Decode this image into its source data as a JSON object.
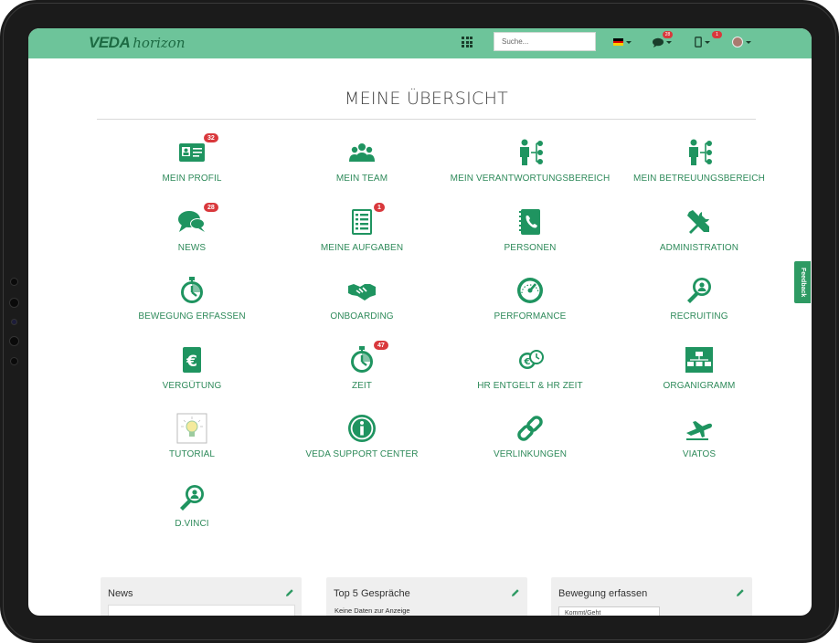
{
  "navbar": {
    "logo_primary": "VEDA",
    "logo_secondary": "horizon",
    "search_placeholder": "Suche...",
    "chat_badge": "28",
    "device_badge": "1",
    "accent_color": "#6dc49a"
  },
  "feedback_label": "Feedback",
  "page_title": "MEINE ÜBERSICHT",
  "tiles": [
    {
      "label": "MEIN PROFIL",
      "badge": "32",
      "icon": "id-card-icon"
    },
    {
      "label": "MEIN TEAM",
      "badge": "",
      "icon": "team-icon"
    },
    {
      "label": "MEIN VERANTWORTUNGSBEREICH",
      "badge": "",
      "icon": "org-person-icon"
    },
    {
      "label": "MEIN BETREUUNGSBEREICH",
      "badge": "",
      "icon": "org-person-icon"
    },
    {
      "label": "NEWS",
      "badge": "28",
      "icon": "chat-bubbles-icon"
    },
    {
      "label": "MEINE AUFGABEN",
      "badge": "1",
      "icon": "checklist-icon"
    },
    {
      "label": "PERSONEN",
      "badge": "",
      "icon": "phonebook-icon"
    },
    {
      "label": "ADMINISTRATION",
      "badge": "",
      "icon": "tools-icon"
    },
    {
      "label": "BEWEGUNG ERFASSEN",
      "badge": "",
      "icon": "stopwatch-icon"
    },
    {
      "label": "ONBOARDING",
      "badge": "",
      "icon": "handshake-icon"
    },
    {
      "label": "PERFORMANCE",
      "badge": "",
      "icon": "speedometer-icon"
    },
    {
      "label": "RECRUITING",
      "badge": "",
      "icon": "search-person-icon"
    },
    {
      "label": "VERGÜTUNG",
      "badge": "",
      "icon": "euro-icon"
    },
    {
      "label": "ZEIT",
      "badge": "47",
      "icon": "stopwatch-icon"
    },
    {
      "label": "HR ENTGELT & HR ZEIT",
      "badge": "",
      "icon": "money-clock-icon"
    },
    {
      "label": "ORGANIGRAMM",
      "badge": "",
      "icon": "org-chart-icon"
    },
    {
      "label": "TUTORIAL",
      "badge": "",
      "icon": "lightbulb-icon"
    },
    {
      "label": "VEDA SUPPORT CENTER",
      "badge": "",
      "icon": "info-icon"
    },
    {
      "label": "VERLINKUNGEN",
      "badge": "",
      "icon": "chain-link-icon"
    },
    {
      "label": "VIATOS",
      "badge": "",
      "icon": "plane-icon"
    },
    {
      "label": "D.VINCI",
      "badge": "",
      "icon": "search-person-icon"
    }
  ],
  "widgets": {
    "news": {
      "title": "News"
    },
    "top5": {
      "title": "Top 5 Gespräche",
      "empty_text": "Keine Daten zur Anzeige"
    },
    "bewegung": {
      "title": "Bewegung erfassen",
      "select_value": "Kommt/Geht"
    }
  }
}
